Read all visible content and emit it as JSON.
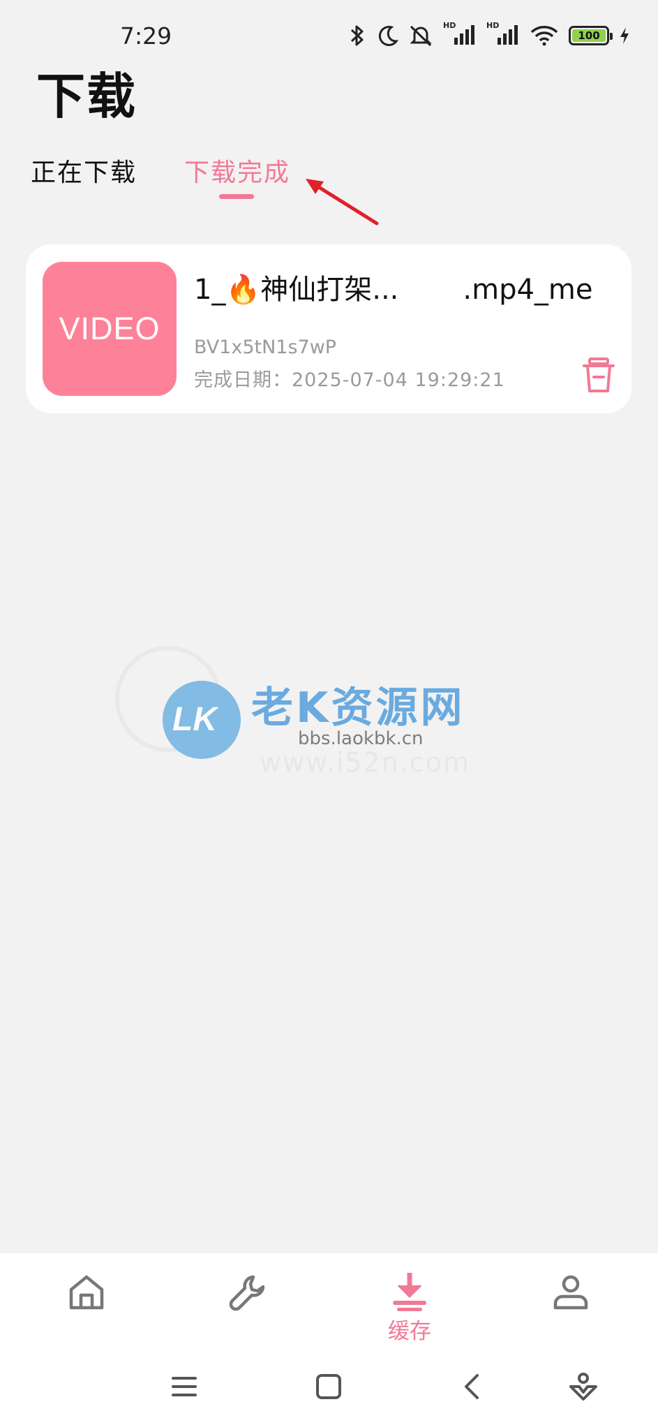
{
  "status_bar": {
    "time": "7:29",
    "battery": "100",
    "hd_label": "HD"
  },
  "page": {
    "title": "下载"
  },
  "tabs": [
    {
      "label": "正在下载",
      "active": false
    },
    {
      "label": "下载完成",
      "active": true
    }
  ],
  "download_item": {
    "thumbnail_label": "VIDEO",
    "title_prefix": "1_🔥神仙打架...",
    "title_suffix": ".mp4_me",
    "bvid": "BV1x5tN1s7wP",
    "completed_label": "完成日期：2025-07-04 19:29:21"
  },
  "watermark": {
    "logo_text": "LK",
    "title": "老K资源网",
    "url": "bbs.laokbk.cn",
    "ghost_url": "www.i52n.com"
  },
  "bottom_nav": {
    "items": [
      {
        "icon": "home-icon",
        "label": ""
      },
      {
        "icon": "wrench-icon",
        "label": ""
      },
      {
        "icon": "download-icon",
        "label": "缓存",
        "active": true
      },
      {
        "icon": "user-icon",
        "label": ""
      }
    ]
  },
  "colors": {
    "accent": "#f07a95",
    "thumbnail": "#fd8299",
    "background": "#f2f2f2",
    "arrow": "#e0202a"
  }
}
